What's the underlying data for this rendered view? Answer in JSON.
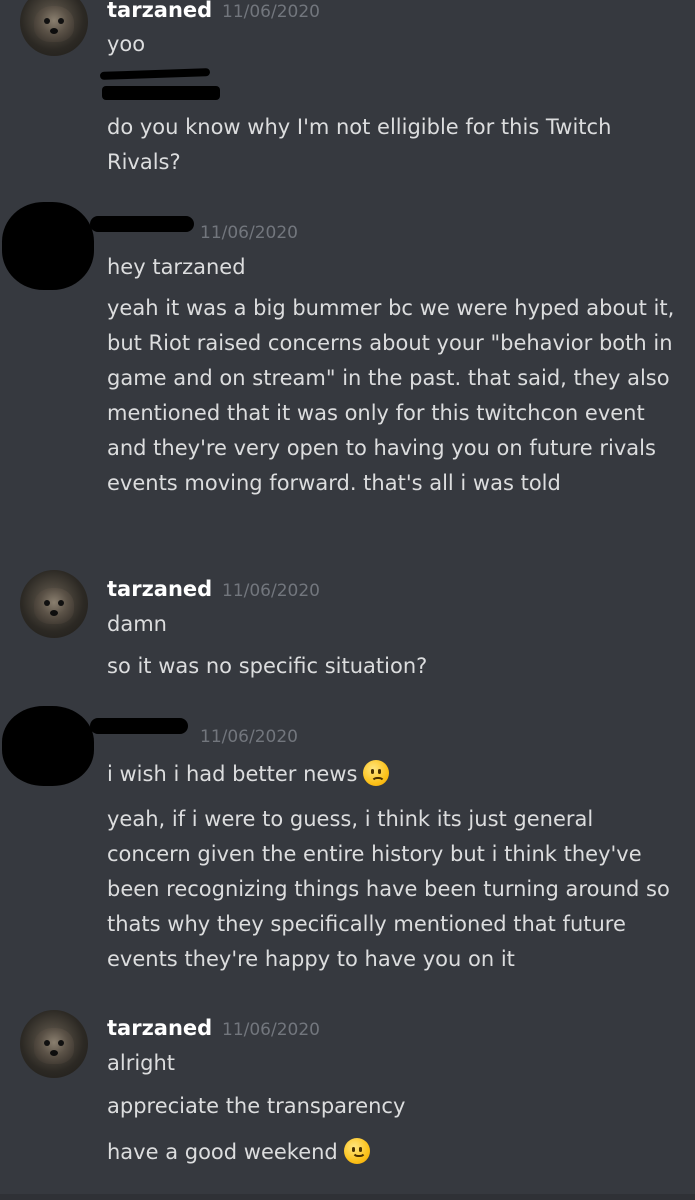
{
  "messages": [
    {
      "author": "tarzaned",
      "timestamp": "11/06/2020",
      "lines": [
        "yoo",
        "do you know why I'm not elligible for this Twitch Rivals?"
      ]
    },
    {
      "author": "",
      "timestamp": "11/06/2020",
      "lines": [
        "hey tarzaned",
        "yeah it was a big bummer bc we were hyped about it, but Riot raised concerns about your \"behavior both in game and on stream\" in the past. that said, they also mentioned that it was only for this twitchcon event and they're very open to having you on future rivals events moving forward. that's all i was told"
      ]
    },
    {
      "author": "tarzaned",
      "timestamp": "11/06/2020",
      "lines": [
        "damn",
        "so it was no specific situation?"
      ]
    },
    {
      "author": "",
      "timestamp": "11/06/2020",
      "lines": [
        "i wish i had better news",
        "yeah, if i were to guess, i think its just general concern given the entire history but i think they've been recognizing things have been turning around so thats why they specifically mentioned that future events they're happy to have you on it"
      ]
    },
    {
      "author": "tarzaned",
      "timestamp": "11/06/2020",
      "lines": [
        "alright",
        "appreciate the transparency",
        "have a good weekend"
      ]
    }
  ],
  "emojis": {
    "frown": "frowning-face-emoji",
    "smile": "slightly-smiling-face-emoji"
  },
  "colors": {
    "background": "#36393f",
    "username": "#ffffff",
    "timestamp": "#72767d",
    "text": "#dcddde",
    "redaction": "#000000"
  }
}
